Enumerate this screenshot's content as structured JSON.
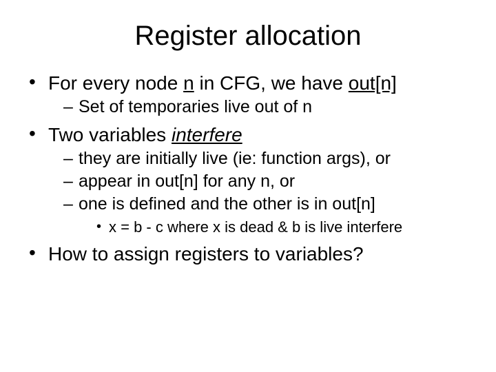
{
  "title": "Register allocation",
  "bullets": {
    "b1_pre": "For every node ",
    "b1_n": "n",
    "b1_mid": " in CFG, we have ",
    "b1_outn": "out[n]",
    "b1_sub": "Set of temporaries live out of n",
    "b2_pre": "Two variables ",
    "b2_interfere": "interfere",
    "b2_sub1": "they are initially live (ie: function args), or",
    "b2_sub2": "appear in out[n] for any n, or",
    "b2_sub3": "one is defined and the other is in out[n]",
    "b2_subsub": "x = b - c    where x is dead & b is live interfere",
    "b3": "How to assign registers to variables?"
  }
}
